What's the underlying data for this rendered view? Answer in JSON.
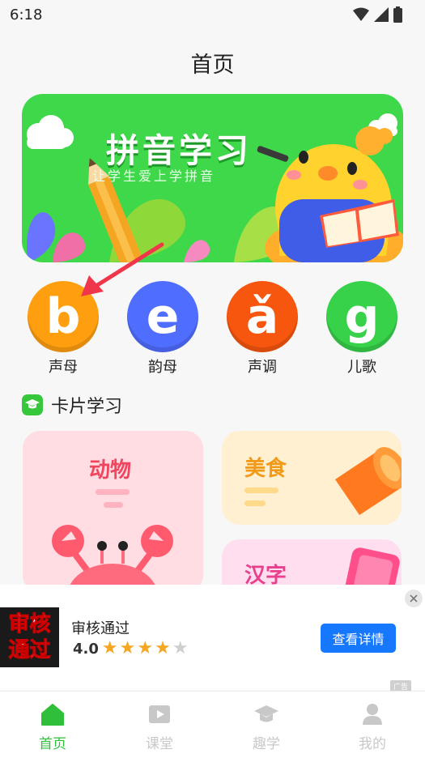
{
  "status": {
    "time": "6:18"
  },
  "page": {
    "title": "首页"
  },
  "banner": {
    "title": "拼音学习",
    "subtitle": "让学生爱上学拼音"
  },
  "pinyin": [
    {
      "letter": "b",
      "label": "声母",
      "color": "#ff9f0f"
    },
    {
      "letter": "e",
      "label": "韵母",
      "color": "#4f6dff"
    },
    {
      "letter": "ǎ",
      "label": "声调",
      "color": "#f7560f"
    },
    {
      "letter": "g",
      "label": "儿歌",
      "color": "#37d14a"
    }
  ],
  "section": {
    "title": "卡片学习"
  },
  "cards": [
    {
      "title": "动物",
      "bg": "#ffdde2",
      "accent": "#f0455f"
    },
    {
      "title": "美食",
      "bg": "#fff0d2",
      "accent": "#f29a18"
    },
    {
      "title": "汉字",
      "bg": "#ffdef0",
      "accent": "#e8408c"
    }
  ],
  "ad": {
    "logo_line1": "审核",
    "logo_line2": "通过",
    "title": "审核通过",
    "rating": "4.0",
    "button": "查看详情",
    "badge": "广告"
  },
  "tabs": [
    {
      "label": "首页",
      "active": true
    },
    {
      "label": "课堂",
      "active": false
    },
    {
      "label": "趣学",
      "active": false
    },
    {
      "label": "我的",
      "active": false
    }
  ],
  "colors": {
    "accent": "#2fbf3a",
    "inactive_tab": "#c8c8c8",
    "star": "#f5a623"
  }
}
